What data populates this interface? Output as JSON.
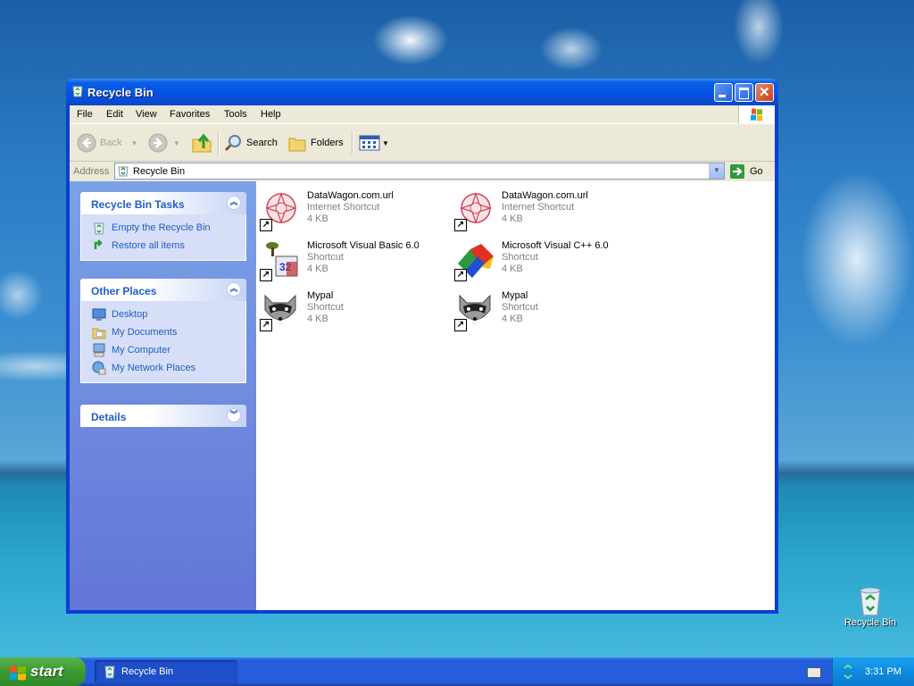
{
  "window": {
    "title": "Recycle Bin"
  },
  "menu": [
    "File",
    "Edit",
    "View",
    "Favorites",
    "Tools",
    "Help"
  ],
  "toolbar": {
    "back_label": "Back",
    "search_label": "Search",
    "folders_label": "Folders"
  },
  "address": {
    "label": "Address",
    "value": "Recycle Bin",
    "go_label": "Go"
  },
  "tasks_panel": {
    "title": "Recycle Bin Tasks",
    "items": [
      {
        "label": "Empty the Recycle Bin",
        "icon": "empty-recycle-bin-icon"
      },
      {
        "label": "Restore all items",
        "icon": "restore-icon"
      }
    ]
  },
  "places_panel": {
    "title": "Other Places",
    "items": [
      {
        "label": "Desktop",
        "icon": "desktop-icon"
      },
      {
        "label": "My Documents",
        "icon": "my-documents-icon"
      },
      {
        "label": "My Computer",
        "icon": "my-computer-icon"
      },
      {
        "label": "My Network Places",
        "icon": "network-places-icon"
      }
    ]
  },
  "details_panel": {
    "title": "Details"
  },
  "files": [
    {
      "name": "DataWagon.com.url",
      "type": "Internet Shortcut",
      "size": "4 KB",
      "icon": "internet-shortcut-icon"
    },
    {
      "name": "DataWagon.com.url",
      "type": "Internet Shortcut",
      "size": "4 KB",
      "icon": "internet-shortcut-icon"
    },
    {
      "name": "Microsoft Visual Basic 6.0",
      "type": "Shortcut",
      "size": "4 KB",
      "icon": "visual-basic-icon"
    },
    {
      "name": "Microsoft Visual C++ 6.0",
      "type": "Shortcut",
      "size": "4 KB",
      "icon": "visual-cpp-icon"
    },
    {
      "name": "Mypal",
      "type": "Shortcut",
      "size": "4 KB",
      "icon": "raccoon-icon"
    },
    {
      "name": "Mypal",
      "type": "Shortcut",
      "size": "4 KB",
      "icon": "raccoon-icon"
    }
  ],
  "desktop": {
    "icon_label": "Recycle Bin"
  },
  "taskbar": {
    "start_label": "start",
    "task_label": "Recycle Bin",
    "clock": "3:31 PM"
  },
  "colors": {
    "titlebar": "#0554e3",
    "taskpane_link": "#215dc6",
    "start_green": "#3c9a33"
  }
}
